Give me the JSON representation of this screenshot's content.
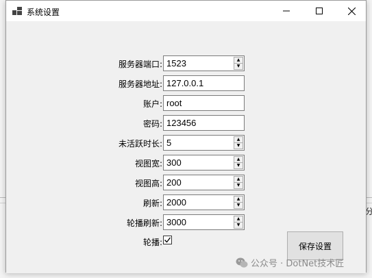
{
  "window": {
    "title": "系统设置",
    "controls": {
      "minimize": "—",
      "maximize": "☐",
      "close": "✕"
    }
  },
  "form": {
    "rows": [
      {
        "label": "服务器端口:",
        "value": "1523",
        "type": "number"
      },
      {
        "label": "服务器地址:",
        "value": "127.0.0.1",
        "type": "text"
      },
      {
        "label": "账户:",
        "value": "root",
        "type": "text"
      },
      {
        "label": "密码:",
        "value": "123456",
        "type": "text"
      },
      {
        "label": "未活跃时长:",
        "value": "5",
        "type": "number"
      },
      {
        "label": "视图宽:",
        "value": "300",
        "type": "number"
      },
      {
        "label": "视图高:",
        "value": "200",
        "type": "number"
      },
      {
        "label": "刷新:",
        "value": "2000",
        "type": "number"
      },
      {
        "label": "轮播刷新:",
        "value": "3000",
        "type": "number"
      }
    ],
    "carousel": {
      "label": "轮播:",
      "checked": true
    }
  },
  "buttons": {
    "save_label": "保存设置"
  },
  "watermark": {
    "text": "公众号 · DotNet技术匠"
  },
  "background": {
    "partial_glyph": "分"
  }
}
